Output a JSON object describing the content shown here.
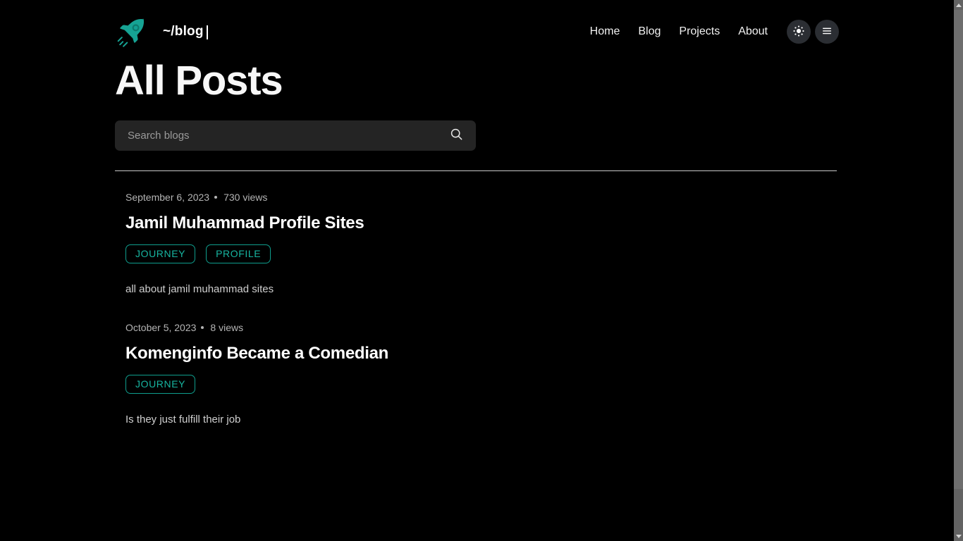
{
  "header": {
    "logo_icon": "rocket-icon",
    "brand_text": "~/blog",
    "nav": [
      {
        "label": "Home"
      },
      {
        "label": "Blog"
      },
      {
        "label": "Projects"
      },
      {
        "label": "About"
      }
    ],
    "theme_toggle_icon": "sun-icon",
    "menu_icon": "hamburger-menu-icon"
  },
  "main": {
    "title": "All Posts",
    "search": {
      "placeholder": "Search blogs",
      "value": "",
      "icon": "search-icon"
    },
    "posts": [
      {
        "date": "September 6, 2023",
        "views": "730 views",
        "title": "Jamil Muhammad Profile Sites",
        "tags": [
          "JOURNEY",
          "PROFILE"
        ],
        "description": "all about jamil muhammad sites"
      },
      {
        "date": "October 5, 2023",
        "views": "8 views",
        "title": "Komenginfo Became a Comedian",
        "tags": [
          "JOURNEY"
        ],
        "description": "Is they just fulfill their job"
      }
    ]
  },
  "colors": {
    "background": "#000000",
    "accent_teal": "#17b5a1",
    "tag_border": "#0f9e8d",
    "search_bg": "#242424",
    "icon_button_bg": "#2b2e33",
    "divider": "#c9c9c9"
  }
}
